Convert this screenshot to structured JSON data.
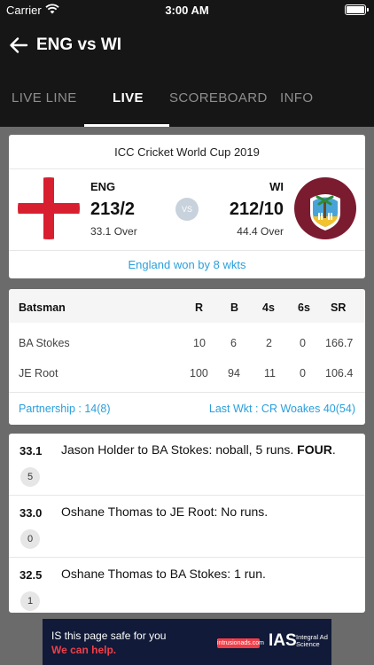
{
  "status_bar": {
    "carrier": "Carrier",
    "time": "3:00 AM"
  },
  "header": {
    "title": "ENG vs WI"
  },
  "tabs": [
    {
      "label": "LIVE LINE",
      "active": false
    },
    {
      "label": "LIVE",
      "active": true
    },
    {
      "label": "SCOREBOARD",
      "active": false
    },
    {
      "label": "INFO",
      "active": false
    }
  ],
  "match": {
    "series": "ICC Cricket World Cup 2019",
    "team1": {
      "name": "ENG",
      "score": "213/2",
      "overs": "33.1 Over"
    },
    "vs": "VS",
    "team2": {
      "name": "WI",
      "score": "212/10",
      "overs": "44.4 Over"
    },
    "result": "England won by 8 wkts"
  },
  "batting": {
    "headers": {
      "name": "Batsman",
      "r": "R",
      "b": "B",
      "fours": "4s",
      "sixes": "6s",
      "sr": "SR"
    },
    "rows": [
      {
        "name": "BA Stokes",
        "r": "10",
        "b": "6",
        "fours": "2",
        "sixes": "0",
        "sr": "166.7"
      },
      {
        "name": "JE Root",
        "r": "100",
        "b": "94",
        "fours": "11",
        "sixes": "0",
        "sr": "106.4"
      }
    ],
    "partnership": "Partnership : 14(8)",
    "last_wicket": "Last Wkt : CR Woakes 40(54)"
  },
  "commentary": [
    {
      "over": "33.1",
      "runs": "5",
      "text": "Jason Holder to BA Stokes: noball, 5 runs. ",
      "highlight": "FOUR",
      "suffix": "."
    },
    {
      "over": "33.0",
      "runs": "0",
      "text": "Oshane Thomas to JE Root: No runs.",
      "highlight": "",
      "suffix": ""
    },
    {
      "over": "32.5",
      "runs": "1",
      "text": "Oshane Thomas to BA Stokes: 1 run.",
      "highlight": "",
      "suffix": ""
    }
  ],
  "ad": {
    "line1": "IS this page safe for you",
    "line2": "We can help.",
    "tag": "intrusionads.com",
    "brand": "IAS",
    "brand_sub": "Integral Ad Science"
  },
  "colors": {
    "accent": "#2a9fdc",
    "header_bg": "#161616",
    "eng_red": "#d81f30",
    "wi_maroon": "#7b1b30"
  }
}
